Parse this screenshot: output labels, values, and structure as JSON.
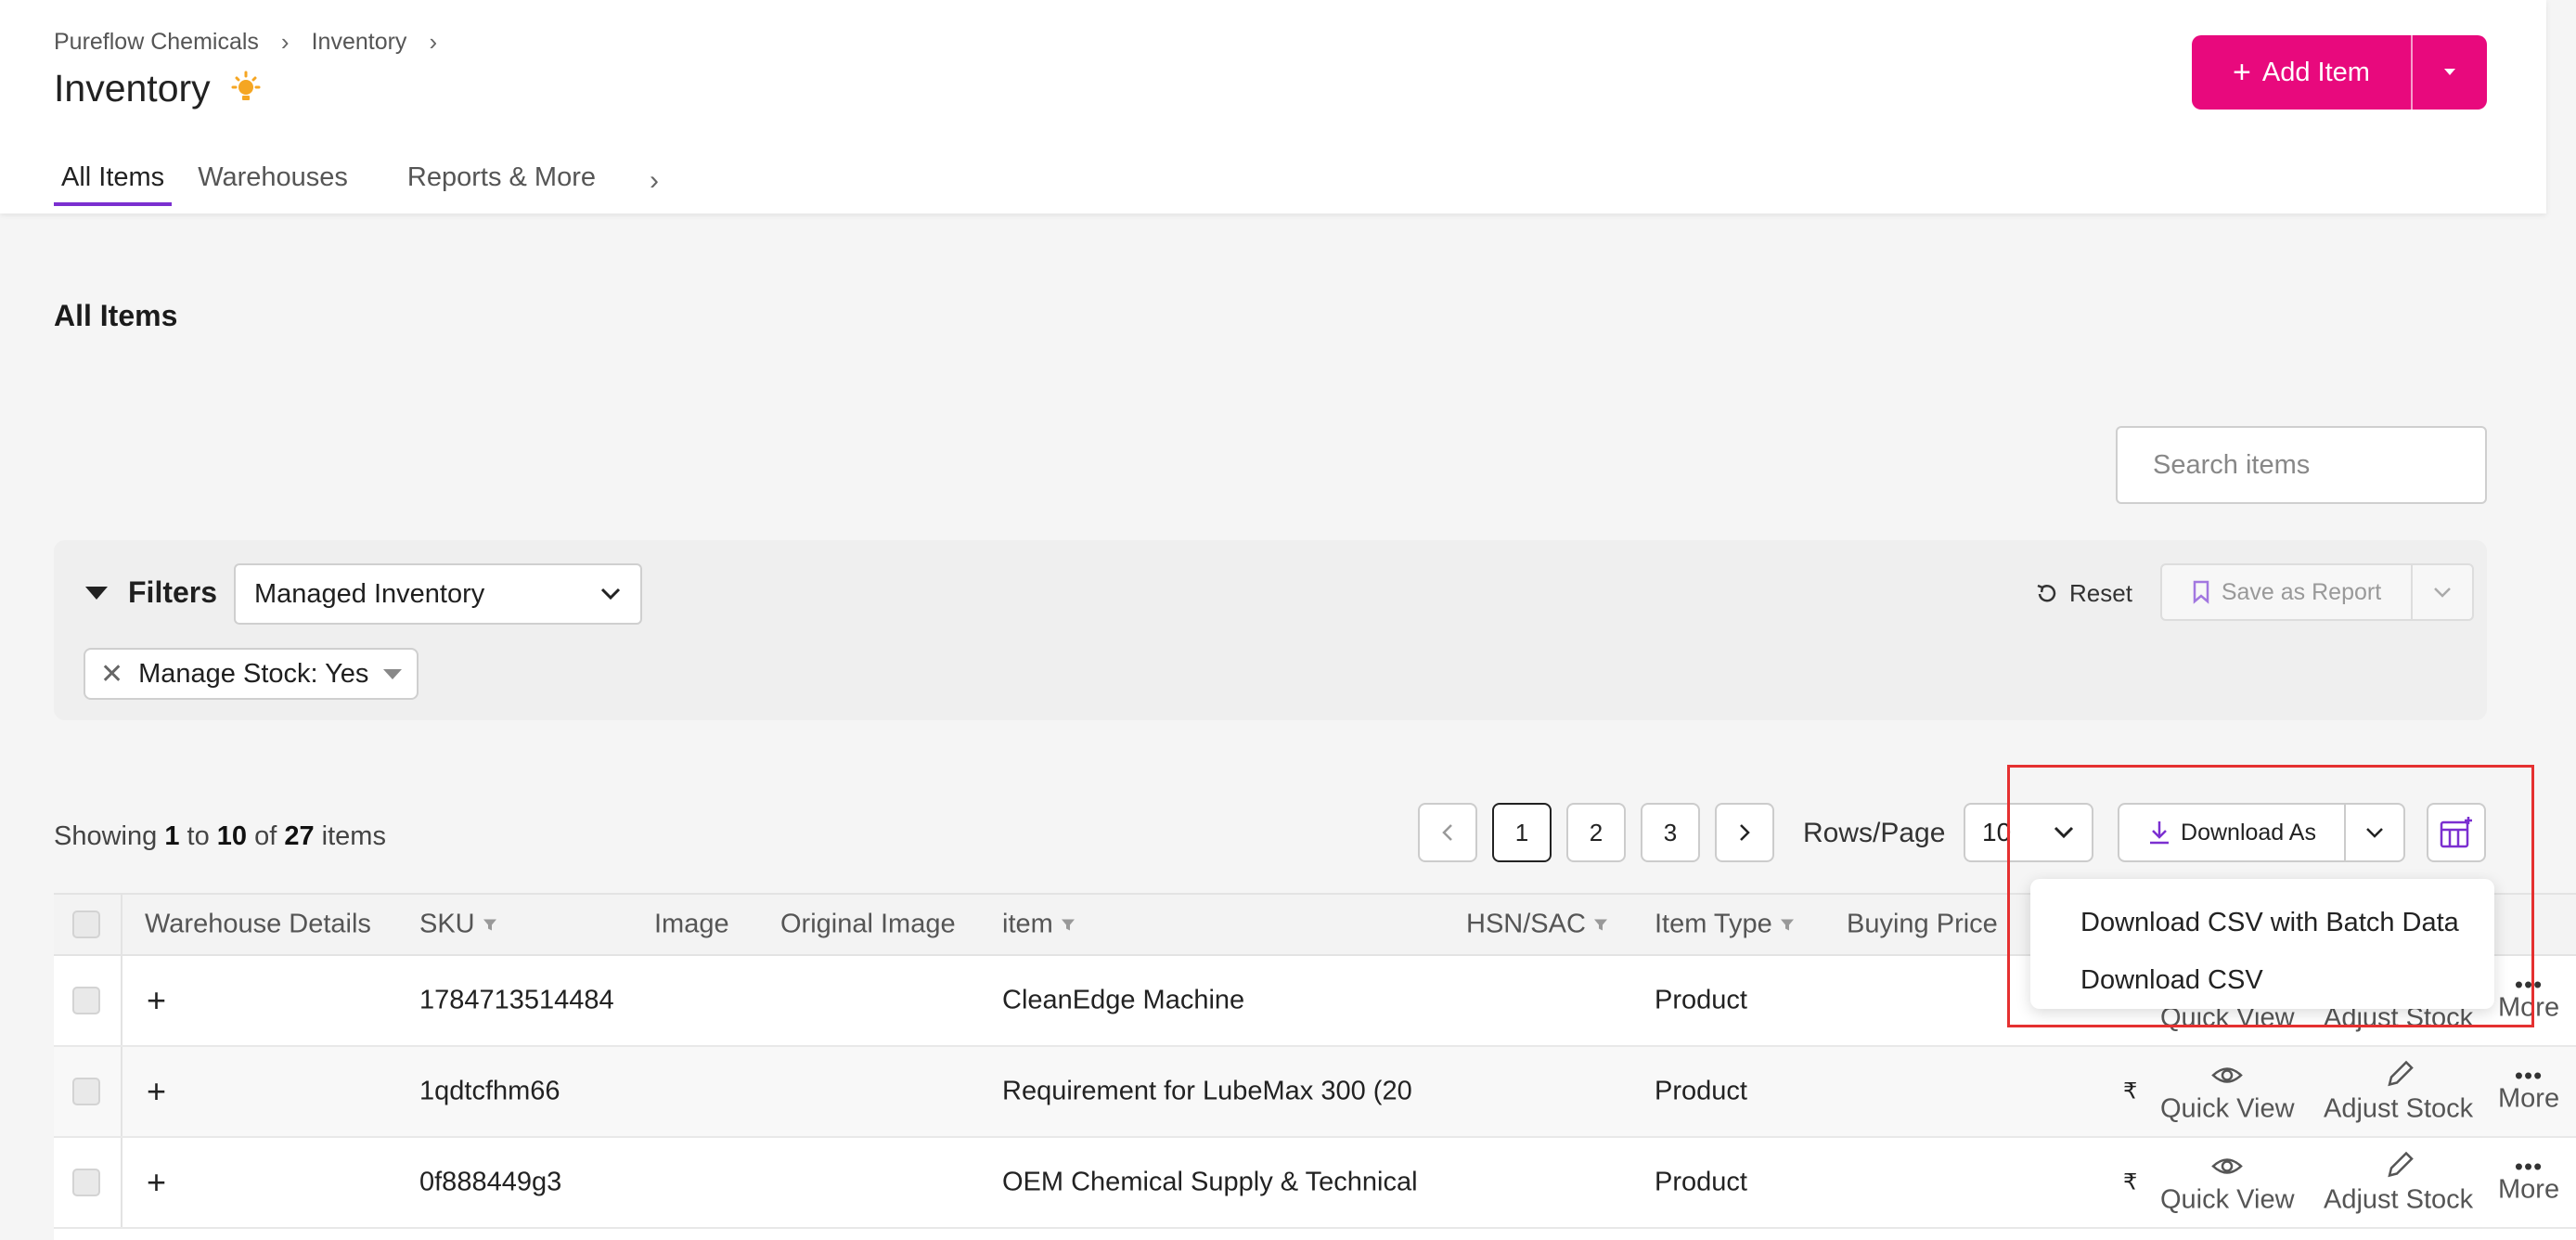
{
  "breadcrumb": {
    "items": [
      "Pureflow Chemicals",
      "Inventory"
    ]
  },
  "page": {
    "title": "Inventory"
  },
  "tabs": [
    {
      "label": "All Items",
      "active": true
    },
    {
      "label": "Warehouses",
      "active": false
    },
    {
      "label": "Reports & More",
      "active": false
    }
  ],
  "header": {
    "add_label": "Add Item"
  },
  "section": {
    "title": "All Items"
  },
  "search": {
    "placeholder": "Search items"
  },
  "filters": {
    "label": "Filters",
    "selected_view": "Managed Inventory",
    "reset_label": "Reset",
    "save_report_label": "Save as Report",
    "chips": [
      {
        "label": "Manage Stock: Yes"
      }
    ]
  },
  "pagination": {
    "showing_prefix": "Showing",
    "from": "1",
    "to_word": "to",
    "to": "10",
    "of_word": "of",
    "total": "27",
    "items_word": "items",
    "pages": [
      "1",
      "2",
      "3"
    ],
    "current_page": "1",
    "rows_label": "Rows/Page",
    "rows_value": "10"
  },
  "download": {
    "label": "Download As",
    "options": [
      "Download CSV with Batch Data",
      "Download CSV"
    ]
  },
  "table": {
    "headers": {
      "warehouse": "Warehouse Details",
      "sku": "SKU",
      "image": "Image",
      "original_image": "Original Image",
      "item": "item",
      "hsn": "HSN/SAC",
      "item_type": "Item Type",
      "buying_price": "Buying Price"
    },
    "rows": [
      {
        "sku": "1784713514484",
        "item": "CleanEdge Machine",
        "item_type": "Product",
        "currency": ""
      },
      {
        "sku": "1qdtcfhm66",
        "item": "Requirement for LubeMax 300 (20",
        "item_type": "Product",
        "currency": "₹"
      },
      {
        "sku": "0f888449g3",
        "item": "OEM Chemical Supply & Technical",
        "item_type": "Product",
        "currency": "₹"
      }
    ],
    "actions": {
      "quick_view": "Quick View",
      "adjust_stock": "Adjust Stock",
      "more": "More",
      "expand": "+"
    }
  },
  "colors": {
    "accent": "#e8097d",
    "tab_underline": "#7b2fd0",
    "highlight": "#e53030"
  }
}
